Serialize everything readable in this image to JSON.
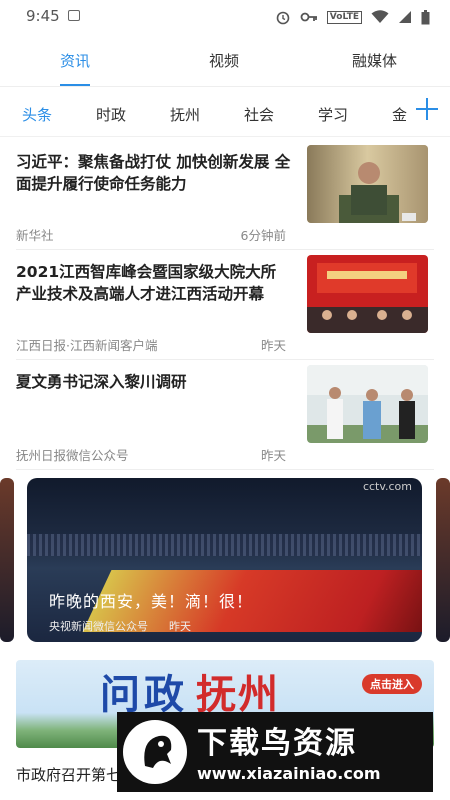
{
  "status": {
    "time": "9:45",
    "volte": "VoLTE"
  },
  "top_tabs": [
    {
      "label": "资讯"
    },
    {
      "label": "视频"
    },
    {
      "label": "融媒体"
    }
  ],
  "categories": [
    "头条",
    "时政",
    "抚州",
    "社会",
    "学习",
    "金"
  ],
  "news": [
    {
      "title": "习近平：聚焦备战打仗 加快创新发展 全面提升履行使命任务能力",
      "source": "新华社",
      "time": "6分钟前"
    },
    {
      "title": "2021江西智库峰会暨国家级大院大所产业技术及高端人才进江西活动开幕",
      "source": "江西日报·江西新闻客户端",
      "time": "昨天"
    },
    {
      "title": "夏文勇书记深入黎川调研",
      "source": "抚州日报微信公众号",
      "time": "昨天"
    }
  ],
  "carousel": {
    "title": "昨晚的西安，美！滴！很！",
    "source": "央视新闻微信公众号",
    "time": "昨天",
    "logo": "cctv.com"
  },
  "banner": {
    "title_a": "问政",
    "title_b": "抚州",
    "enter": "点击进入"
  },
  "bottom_title": "市政府召开第七",
  "watermark": {
    "title": "下载鸟资源",
    "url": "www.xiazainiao.com"
  }
}
